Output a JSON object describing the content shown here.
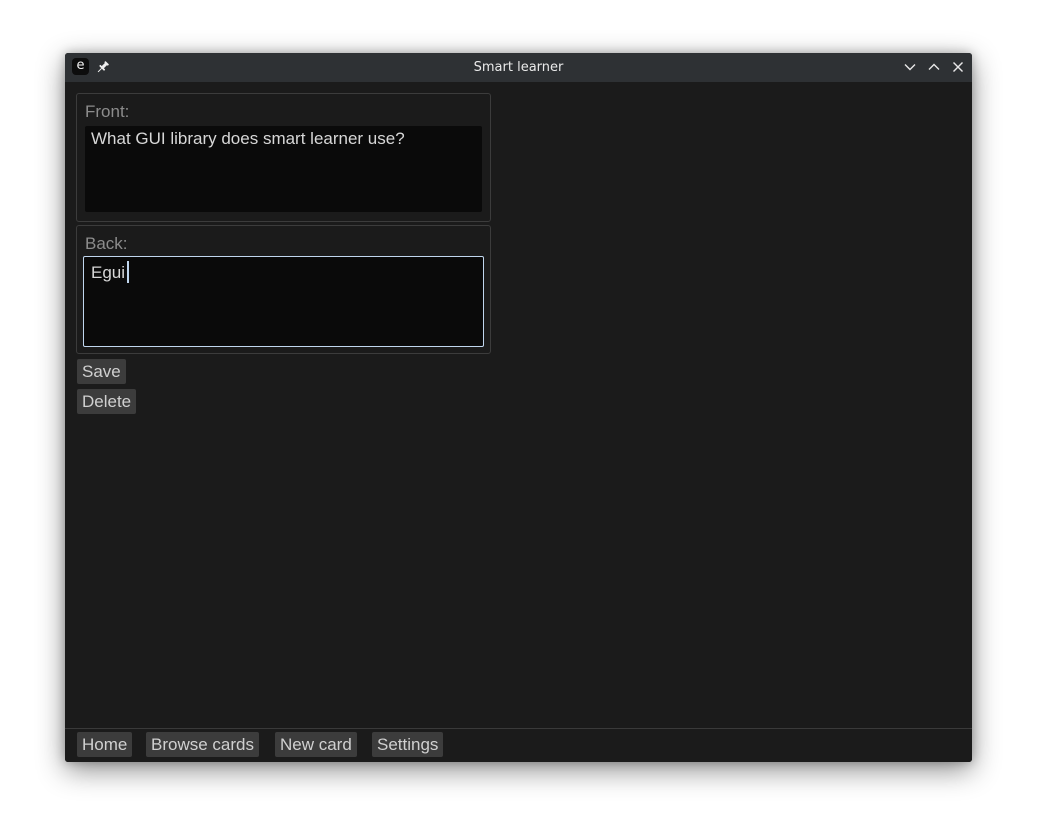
{
  "window": {
    "title": "Smart learner",
    "app_icon_letter": "e",
    "icons": {
      "pin": "pin-icon",
      "minimize": "chevron-down-icon",
      "maximize": "chevron-up-icon",
      "close": "close-icon"
    }
  },
  "editor": {
    "front_label": "Front:",
    "front_value": "What GUI library does smart learner use?",
    "back_label": "Back:",
    "back_value": "Egui",
    "save_label": "Save",
    "delete_label": "Delete"
  },
  "nav": {
    "home": "Home",
    "browse": "Browse cards",
    "new_card": "New card",
    "settings": "Settings"
  },
  "colors": {
    "window_bg": "#1b1b1b",
    "titlebar_bg": "#2e3134",
    "button_bg": "#3c3c3c",
    "textarea_bg": "#0a0a0a",
    "focus_accent": "#c0d6ee"
  }
}
